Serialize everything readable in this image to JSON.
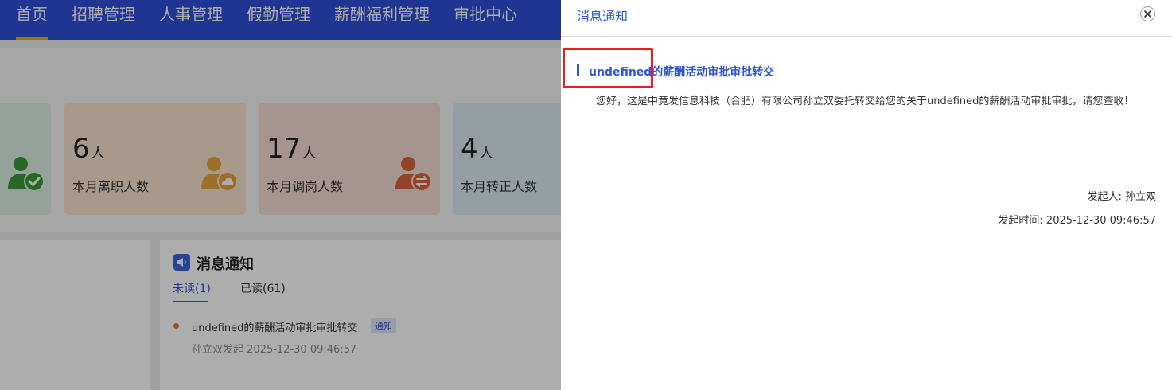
{
  "nav": {
    "items": [
      {
        "label": "首页",
        "active": true
      },
      {
        "label": "招聘管理"
      },
      {
        "label": "人事管理"
      },
      {
        "label": "假勤管理"
      },
      {
        "label": "薪酬福利管理"
      },
      {
        "label": "审批中心"
      }
    ]
  },
  "stats": [
    {
      "value": "6",
      "unit": "人",
      "label": "本月离职人数",
      "icon": "user-cloud-icon"
    },
    {
      "value": "17",
      "unit": "人",
      "label": "本月调岗人数",
      "icon": "user-transfer-icon"
    },
    {
      "value": "4",
      "unit": "人",
      "label": "本月转正人数"
    }
  ],
  "messages": {
    "heading": "消息通知",
    "tabs": {
      "unread": "未读(1)",
      "read": "已读(61)"
    },
    "items": [
      {
        "title": "undefined的薪酬活动审批审批转交",
        "badge": "通知",
        "meta": "孙立双发起   2025-12-30 09:46:57"
      }
    ]
  },
  "drawer": {
    "title": "消息通知",
    "detail": {
      "title": "undefined的薪酬活动审批审批转交",
      "body": "您好，这是中竟发信息科技（合肥）有限公司孙立双委托转交给您的关于undefined的薪酬活动审批审批，请您查收！",
      "sender": "发起人: 孙立双",
      "time": "发起时间: 2025-12-30 09:46:57"
    }
  },
  "colors": {
    "nav_bg": "#2f4fd6",
    "accent": "#2f55d4",
    "highlight": "#ee1c1c"
  }
}
